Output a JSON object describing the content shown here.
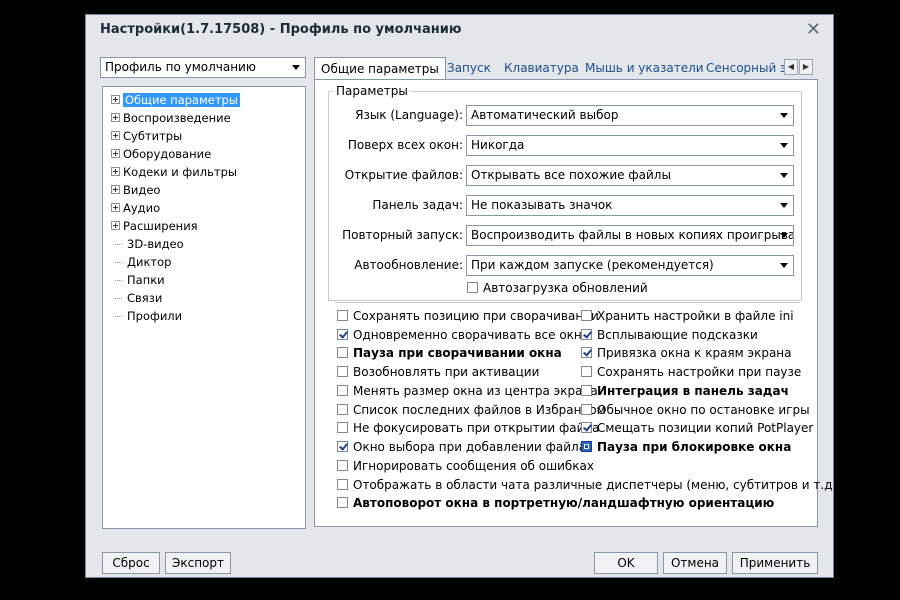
{
  "window": {
    "title": "Настройки(1.7.17508) - Профиль по умолчанию"
  },
  "profile": {
    "selected": "Профиль по умолчанию"
  },
  "tree": [
    {
      "label": "Общие параметры",
      "expandable": true,
      "selected": true
    },
    {
      "label": "Воспроизведение",
      "expandable": true
    },
    {
      "label": "Субтитры",
      "expandable": true
    },
    {
      "label": "Оборудование",
      "expandable": true
    },
    {
      "label": "Кодеки и фильтры",
      "expandable": true
    },
    {
      "label": "Видео",
      "expandable": true
    },
    {
      "label": "Аудио",
      "expandable": true
    },
    {
      "label": "Расширения",
      "expandable": true
    },
    {
      "label": "3D-видео",
      "expandable": false
    },
    {
      "label": "Диктор",
      "expandable": false
    },
    {
      "label": "Папки",
      "expandable": false
    },
    {
      "label": "Связи",
      "expandable": false
    },
    {
      "label": "Профили",
      "expandable": false
    }
  ],
  "tabs": [
    {
      "label": "Общие параметры",
      "active": true
    },
    {
      "label": "Запуск"
    },
    {
      "label": "Клавиатура"
    },
    {
      "label": "Мышь и указатели"
    },
    {
      "label": "Сенсорный эк"
    }
  ],
  "params": {
    "group_label": "Параметры",
    "rows": [
      {
        "label": "Язык (Language):",
        "value": "Автоматический выбор"
      },
      {
        "label": "Поверх всех окон:",
        "value": "Никогда"
      },
      {
        "label": "Открытие файлов:",
        "value": "Открывать все похожие файлы"
      },
      {
        "label": "Панель задач:",
        "value": "Не показывать значок"
      },
      {
        "label": "Повторный запуск:",
        "value": "Воспроизводить файлы в новых копиях проигрывателя"
      },
      {
        "label": "Автообновление:",
        "value": "При каждом запуске (рекомендуется)"
      }
    ],
    "autoload": {
      "label": "Автозагрузка обновлений",
      "checked": false
    }
  },
  "checks_left": [
    {
      "label": "Сохранять позицию при сворачивании",
      "checked": false
    },
    {
      "label": "Одновременно сворачивать все окна",
      "checked": true
    },
    {
      "label": "Пауза при сворачивании окна",
      "checked": false,
      "bold": true
    },
    {
      "label": "Возобновлять при активации",
      "checked": false
    },
    {
      "label": "Менять размер окна из центра экрана",
      "checked": false
    },
    {
      "label": "Список последних файлов в Избранном",
      "checked": false
    },
    {
      "label": "Не фокусировать при открытии файла",
      "checked": false
    },
    {
      "label": "Окно выбора при добавлении файла",
      "checked": true
    },
    {
      "label": "Игнорировать сообщения об ошибках",
      "checked": false
    },
    {
      "label": "Отображать в области чата различные диспетчеры (меню, субтитров и т.д.)",
      "checked": false
    },
    {
      "label": "Автоповорот окна в портретную/ландшафтную ориентацию",
      "checked": false,
      "bold": true
    }
  ],
  "checks_right": [
    {
      "label": "Хранить настройки в файле ini",
      "checked": false
    },
    {
      "label": "Всплывающие подсказки",
      "checked": true
    },
    {
      "label": "Привязка окна к краям экрана",
      "checked": true
    },
    {
      "label": "Сохранять настройки при паузе",
      "checked": false
    },
    {
      "label": "Интеграция в панель задач",
      "checked": false,
      "bold": true
    },
    {
      "label": "Обычное окно по остановке игры",
      "checked": false
    },
    {
      "label": "Смещать позиции копий PotPlayer",
      "checked": true
    },
    {
      "label": "Пауза при блокировке окна",
      "checked": "indeterminate",
      "bold": true
    }
  ],
  "buttons": {
    "reset": "Сброс",
    "export": "Экспорт",
    "ok": "OK",
    "cancel": "Отмена",
    "apply": "Применить"
  }
}
